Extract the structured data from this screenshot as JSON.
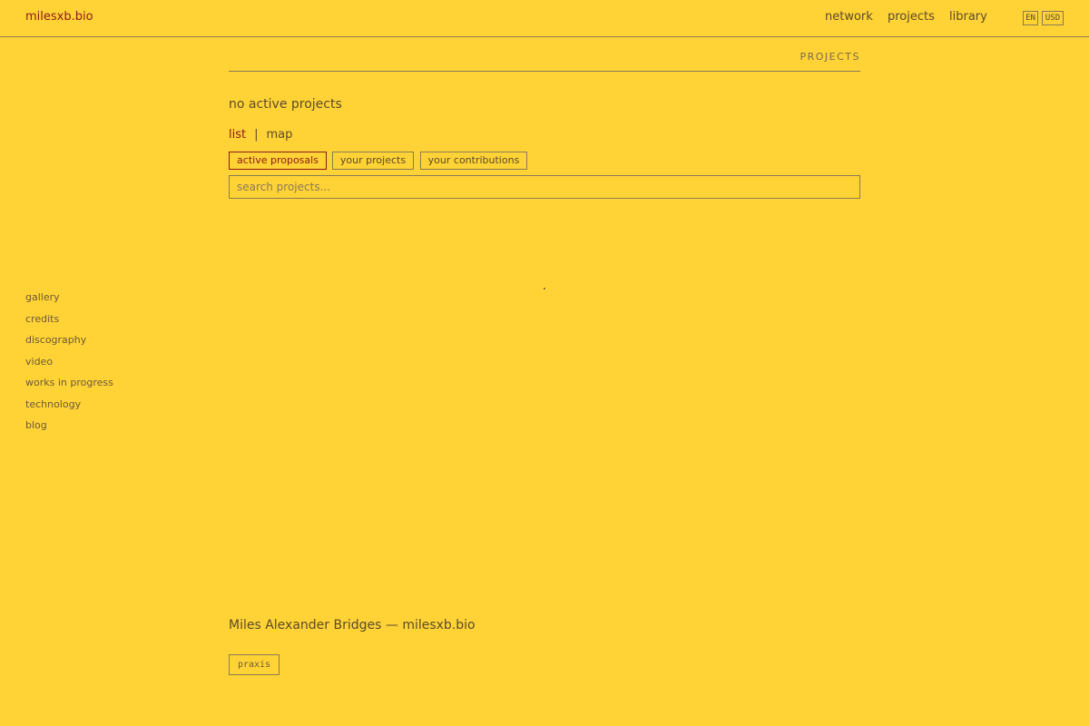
{
  "brand": "milesxb.bio",
  "topnav": [
    "network",
    "projects",
    "library"
  ],
  "locale": {
    "language": "EN",
    "currency": "USD"
  },
  "sidebar": {
    "items": [
      "gallery",
      "credits",
      "discography",
      "video",
      "works in progress",
      "technology",
      "blog"
    ]
  },
  "page": {
    "section_title": "PROJECTS",
    "status": "no active projects",
    "view_toggle": {
      "active": "list",
      "separator": "|",
      "other": "map"
    },
    "filters": {
      "selected": "active proposals",
      "items": [
        "active proposals",
        "your projects",
        "your contributions"
      ]
    },
    "search": {
      "placeholder": "search projects...",
      "value": ""
    }
  },
  "footer": {
    "title": "Miles Alexander Bridges — milesxb.bio",
    "tag": "praxis"
  },
  "colors": {
    "background": "#FFD335",
    "accent": "#8b1a1a",
    "text": "#5b4a2a",
    "border": "#8a7a55"
  }
}
